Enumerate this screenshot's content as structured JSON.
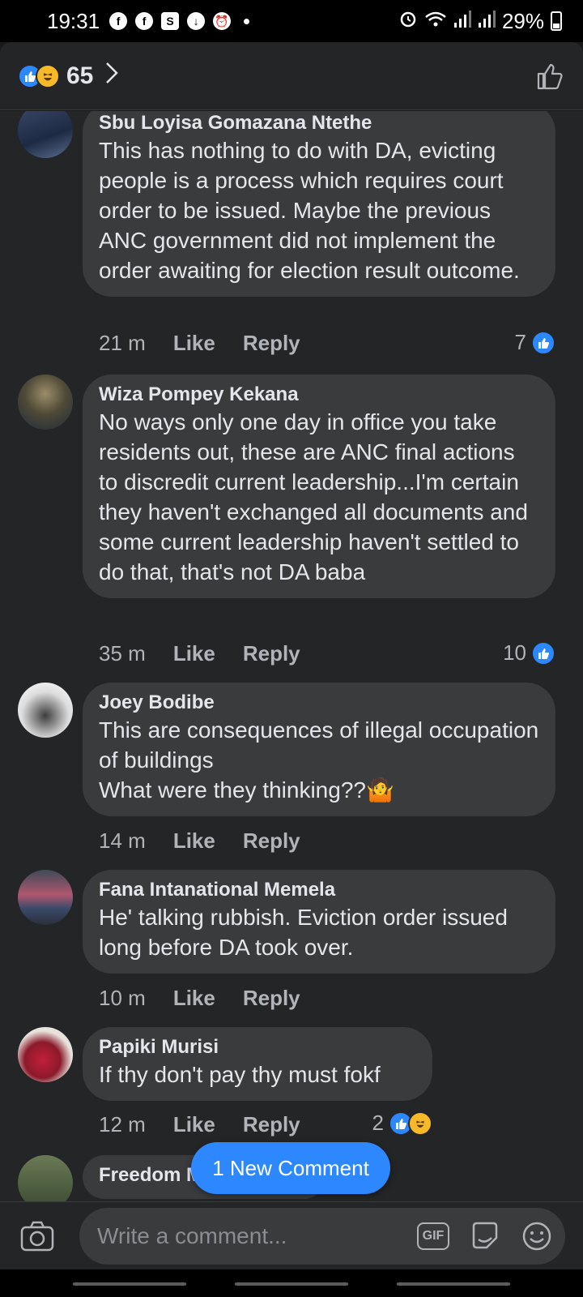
{
  "status_bar": {
    "time": "19:31",
    "battery": "29%",
    "left_icons": [
      "facebook-icon",
      "facebook-icon",
      "s-icon",
      "download-icon",
      "alarm-icon"
    ],
    "right_icons": [
      "alarm-icon",
      "wifi-icon",
      "signal-icon",
      "signal-icon",
      "battery-icon"
    ]
  },
  "reactions": {
    "count": "65",
    "types": [
      "like",
      "haha"
    ]
  },
  "comments": [
    {
      "author": "Sbu Loyisa Gomazana Ntethe",
      "text": "This has nothing to do with DA, evicting people is a process which requires court order to be issued. Maybe the previous ANC government did not implement the order awaiting for election result outcome.",
      "time": "21 m",
      "like_label": "Like",
      "reply_label": "Reply",
      "likes": "7"
    },
    {
      "author": "Wiza Pompey Kekana",
      "text": "No ways only one day in office you take residents out, these are ANC final actions to discredit current leadership...I'm certain they haven't exchanged all documents and some current leadership haven't settled to do that, that's not DA baba",
      "time": "35 m",
      "like_label": "Like",
      "reply_label": "Reply",
      "likes": "10"
    },
    {
      "author": "Joey Bodibe",
      "text": "This are consequences of illegal occupation of buildings\nWhat were they thinking??🤷",
      "time": "14 m",
      "like_label": "Like",
      "reply_label": "Reply",
      "likes": ""
    },
    {
      "author": "Fana Intanational Memela",
      "text": "He' talking rubbish. Eviction order issued long before DA took over.",
      "time": "10 m",
      "like_label": "Like",
      "reply_label": "Reply",
      "likes": ""
    },
    {
      "author": "Papiki Murisi",
      "text": "If thy don't pay thy must fokf",
      "time": "12 m",
      "like_label": "Like",
      "reply_label": "Reply",
      "likes": "2"
    },
    {
      "author": "Freedom Maphosa",
      "text": "",
      "time": "",
      "like_label": "",
      "reply_label": "",
      "likes": ""
    }
  ],
  "new_comment_pill": "1 New Comment",
  "composer": {
    "placeholder": "Write a comment...",
    "gif_label": "GIF"
  },
  "colors": {
    "background": "#18191a",
    "surface": "#242526",
    "bubble": "#3a3b3c",
    "accent": "#2d88ff",
    "text_primary": "#e4e6eb",
    "text_secondary": "#b0b3b8"
  }
}
